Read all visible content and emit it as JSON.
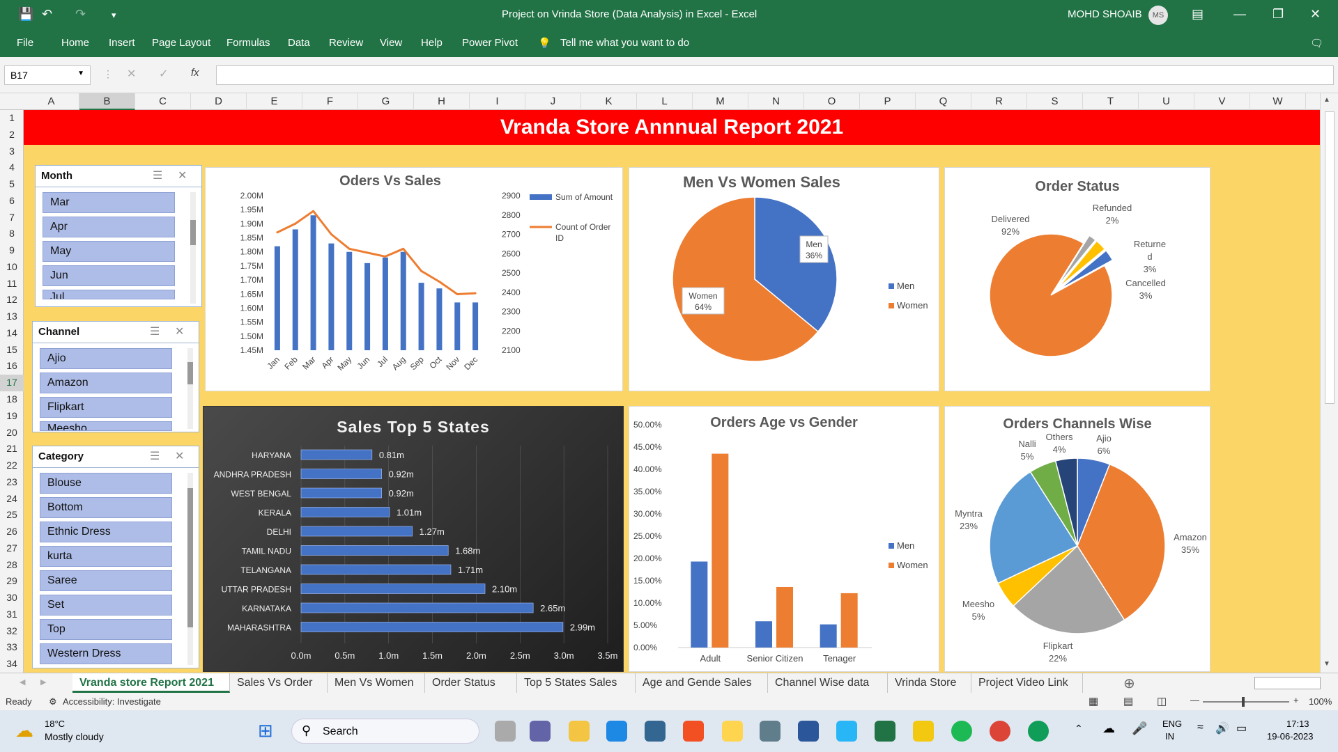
{
  "window": {
    "title": "Project on Vrinda Store (Data Analysis) in Excel  -  Excel",
    "user": "MOHD SHOAIB",
    "user_initials": "MS"
  },
  "ribbon_tabs": [
    "File",
    "Home",
    "Insert",
    "Page Layout",
    "Formulas",
    "Data",
    "Review",
    "View",
    "Help",
    "Power Pivot"
  ],
  "tell_me": "Tell me what you want to do",
  "name_box": "B17",
  "fx": "fx",
  "columns": [
    "A",
    "B",
    "C",
    "D",
    "E",
    "F",
    "G",
    "H",
    "I",
    "J",
    "K",
    "L",
    "M",
    "N",
    "O",
    "P",
    "Q",
    "R",
    "S",
    "T",
    "U",
    "V",
    "W"
  ],
  "rows": [
    "1",
    "2",
    "3",
    "4",
    "5",
    "6",
    "7",
    "8",
    "9",
    "10",
    "11",
    "12",
    "13",
    "14",
    "15",
    "16",
    "17",
    "18",
    "19",
    "20",
    "21",
    "22",
    "23",
    "24",
    "25",
    "26",
    "27",
    "28",
    "29",
    "30",
    "31",
    "32",
    "33",
    "34"
  ],
  "banner": "Vranda Store Annnual Report 2021",
  "slicers": {
    "month": {
      "title": "Month",
      "items": [
        "Mar",
        "Apr",
        "May",
        "Jun",
        "Jul"
      ]
    },
    "channel": {
      "title": "Channel",
      "items": [
        "Ajio",
        "Amazon",
        "Flipkart",
        "Meesho"
      ]
    },
    "category": {
      "title": "Category",
      "items": [
        "Blouse",
        "Bottom",
        "Ethnic Dress",
        "kurta",
        "Saree",
        "Set",
        "Top",
        "Western Dress"
      ]
    }
  },
  "charts": {
    "orders_sales": {
      "title": "Oders Vs Sales",
      "legend_amount": "Sum of Amount",
      "legend_count_1": "Count of Order",
      "legend_count_2": "ID"
    },
    "men_women": {
      "title": "Men Vs Women Sales",
      "men_label": "Men",
      "men_pct": "36%",
      "women_label": "Women",
      "women_pct": "64%",
      "legend_men": "Men",
      "legend_women": "Women"
    },
    "order_status": {
      "title": "Order Status",
      "delivered": "Delivered",
      "delivered_pct": "92%",
      "refunded": "Refunded",
      "refunded_pct": "2%",
      "returned_1": "Returne",
      "returned_2": "d",
      "returned_pct": "3%",
      "cancelled": "Cancelled",
      "cancelled_pct": "3%"
    },
    "top_states": {
      "title": "Sales  Top 5 States"
    },
    "age_gender": {
      "title": "Orders Age vs Gender",
      "legend_men": "Men",
      "legend_women": "Women"
    },
    "channels": {
      "title": "Orders  Channels Wise"
    }
  },
  "chart_data": [
    {
      "type": "bar",
      "title": "Oders Vs Sales",
      "categories": [
        "Jan",
        "Feb",
        "Mar",
        "Apr",
        "May",
        "Jun",
        "Jul",
        "Aug",
        "Sep",
        "Oct",
        "Nov",
        "Dec"
      ],
      "series": [
        {
          "name": "Sum of Amount",
          "type": "bar",
          "values": [
            1.82,
            1.88,
            1.93,
            1.83,
            1.8,
            1.76,
            1.78,
            1.8,
            1.69,
            1.67,
            1.62,
            1.62
          ]
        },
        {
          "name": "Count of Order ID",
          "type": "line",
          "axis": "secondary",
          "values": [
            2710,
            2755,
            2820,
            2700,
            2625,
            2605,
            2585,
            2625,
            2510,
            2455,
            2390,
            2395
          ]
        }
      ],
      "ylim": [
        1.45,
        2.0
      ],
      "y_ticks": [
        "2.00M",
        "1.95M",
        "1.90M",
        "1.85M",
        "1.80M",
        "1.75M",
        "1.70M",
        "1.65M",
        "1.60M",
        "1.55M",
        "1.50M",
        "1.45M"
      ],
      "y2lim": [
        2100,
        2900
      ],
      "y2_ticks": [
        "2900",
        "2800",
        "2700",
        "2600",
        "2500",
        "2400",
        "2300",
        "2200",
        "2100"
      ],
      "legend": "right"
    },
    {
      "type": "pie",
      "title": "Men Vs Women Sales",
      "categories": [
        "Men",
        "Women"
      ],
      "values": [
        36,
        64
      ],
      "colors": [
        "#4472c4",
        "#ed7d31"
      ],
      "legend": "right"
    },
    {
      "type": "pie",
      "title": "Order Status",
      "categories": [
        "Delivered",
        "Refunded",
        "Returned",
        "Cancelled"
      ],
      "values": [
        92,
        2,
        3,
        3
      ],
      "colors": [
        "#ed7d31",
        "#a5a5a5",
        "#ffc000",
        "#4472c4"
      ]
    },
    {
      "type": "bar",
      "orientation": "horizontal",
      "title": "Sales  Top 5 States",
      "categories": [
        "HARYANA",
        "ANDHRA PRADESH",
        "WEST BENGAL",
        "KERALA",
        "DELHI",
        "TAMIL NADU",
        "TELANGANA",
        "UTTAR PRADESH",
        "KARNATAKA",
        "MAHARASHTRA"
      ],
      "values": [
        0.81,
        0.92,
        0.92,
        1.01,
        1.27,
        1.68,
        1.71,
        2.1,
        2.65,
        2.99
      ],
      "data_labels": [
        "0.81m",
        "0.92m",
        "0.92m",
        "1.01m",
        "1.27m",
        "1.68m",
        "1.71m",
        "2.10m",
        "2.65m",
        "2.99m"
      ],
      "xlim": [
        0,
        3.5
      ],
      "x_ticks": [
        "0.0m",
        "0.5m",
        "1.0m",
        "1.5m",
        "2.0m",
        "2.5m",
        "3.0m",
        "3.5m"
      ]
    },
    {
      "type": "bar",
      "title": "Orders Age vs Gender",
      "categories": [
        "Adult",
        "Senior Citizen",
        "Tenager"
      ],
      "series": [
        {
          "name": "Men",
          "values": [
            19.3,
            5.9,
            5.2
          ]
        },
        {
          "name": "Women",
          "values": [
            43.5,
            13.6,
            12.2
          ]
        }
      ],
      "ylim": [
        0,
        50
      ],
      "y_ticks": [
        "50.00%",
        "45.00%",
        "40.00%",
        "35.00%",
        "30.00%",
        "25.00%",
        "20.00%",
        "15.00%",
        "10.00%",
        "5.00%",
        "0.00%"
      ],
      "legend": "right"
    },
    {
      "type": "pie",
      "title": "Orders  Channels Wise",
      "categories": [
        "Ajio",
        "Amazon",
        "Flipkart",
        "Meesho",
        "Myntra",
        "Nalli",
        "Others"
      ],
      "values": [
        6,
        35,
        22,
        5,
        23,
        5,
        4
      ],
      "labels_pct": [
        "6%",
        "35%",
        "22%",
        "5%",
        "23%",
        "5%",
        "4%"
      ],
      "colors": [
        "#4472c4",
        "#ed7d31",
        "#a5a5a5",
        "#ffc000",
        "#5b9bd5",
        "#70ad47",
        "#264478"
      ]
    }
  ],
  "sheet_tabs": [
    "Vranda store Report 2021",
    "Sales Vs Order",
    "Men Vs Women",
    "Order Status",
    "Top 5 States Sales",
    "Age and Gende Sales",
    "Channel Wise data",
    "Vrinda Store",
    "Project Video Link"
  ],
  "status": {
    "ready": "Ready",
    "accessibility": "Accessibility: Investigate",
    "zoom": "100%"
  },
  "taskbar": {
    "temp": "18°C",
    "weather": "Mostly cloudy",
    "search": "Search",
    "lang1": "ENG",
    "lang2": "IN",
    "time": "17:13",
    "date": "19-06-2023"
  }
}
